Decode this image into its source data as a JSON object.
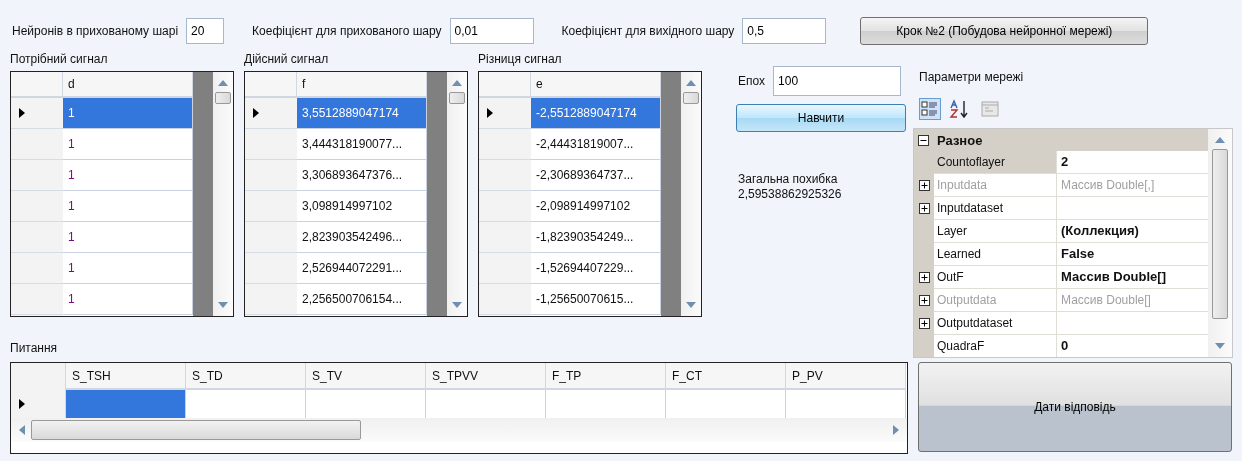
{
  "settings": [
    {
      "label": "Нейронів в прихованому шарі",
      "value": "20"
    },
    {
      "label": "Коефіцієнт для прихованого шару",
      "value": "0,01"
    },
    {
      "label": "Коефіцієнт для вихідного шару",
      "value": "0,5"
    }
  ],
  "build_button": "Крок №2 (Побудова нейронної мережі)",
  "grids": [
    {
      "title": "Потрібний сигнал",
      "column": "d",
      "rows": [
        {
          "value": "1",
          "selected": true
        },
        {
          "value": "1",
          "selected": false
        },
        {
          "value": "1",
          "selected": false
        },
        {
          "value": "1",
          "selected": false
        },
        {
          "value": "1",
          "selected": false
        },
        {
          "value": "1",
          "selected": false
        },
        {
          "value": "1",
          "selected": false
        }
      ]
    },
    {
      "title": "Дійсний сигнал",
      "column": "f",
      "rows": [
        {
          "value": "3,5512889047174",
          "selected": true
        },
        {
          "value": "3,444318190077...",
          "selected": false
        },
        {
          "value": "3,306893647376...",
          "selected": false
        },
        {
          "value": "3,098914997102",
          "selected": false
        },
        {
          "value": "2,823903542496...",
          "selected": false
        },
        {
          "value": "2,526944072291...",
          "selected": false
        },
        {
          "value": "2,256500706154...",
          "selected": false
        }
      ]
    },
    {
      "title": "Різниця сигнал",
      "column": "e",
      "rows": [
        {
          "value": "-2,5512889047174",
          "selected": true
        },
        {
          "value": "-2,44431819007...",
          "selected": false
        },
        {
          "value": "-2,30689364737...",
          "selected": false
        },
        {
          "value": "-2,098914997102",
          "selected": false
        },
        {
          "value": "-1,82390354249...",
          "selected": false
        },
        {
          "value": "-1,52694407229...",
          "selected": false
        },
        {
          "value": "-1,25650070615...",
          "selected": false
        }
      ]
    }
  ],
  "epochs": {
    "label": "Епох",
    "value": "100"
  },
  "train_button": "Навчити",
  "total_error": {
    "label": "Загальна похибка",
    "value": "2,59538862925326"
  },
  "properties": {
    "title": "Параметри мережі",
    "toolbar": [
      {
        "kind": "categorized",
        "selected": true
      },
      {
        "kind": "alphabetical",
        "selected": false
      },
      {
        "kind": "pages",
        "selected": false
      }
    ],
    "category": "Разное",
    "rows": [
      {
        "name": "Countoflayer",
        "value": "2",
        "expandable": false,
        "disabled": false,
        "bold": true,
        "selected": true
      },
      {
        "name": "Inputdata",
        "value": "Массив Double[,]",
        "expandable": true,
        "disabled": true,
        "bold": false,
        "selected": false
      },
      {
        "name": "Inputdataset",
        "expandable": true,
        "disabled": false,
        "bold": false,
        "selected": false
      },
      {
        "name": "Layer",
        "value": "(Коллекция)",
        "expandable": false,
        "disabled": false,
        "bold": true,
        "selected": false
      },
      {
        "name": "Learned",
        "value": "False",
        "expandable": false,
        "disabled": false,
        "bold": true,
        "selected": false
      },
      {
        "name": "OutF",
        "value": "Массив Double[]",
        "expandable": true,
        "disabled": false,
        "bold": true,
        "selected": false
      },
      {
        "name": "Outputdata",
        "value": "Массив Double[]",
        "expandable": true,
        "disabled": true,
        "bold": false,
        "selected": false
      },
      {
        "name": "Outputdataset",
        "expandable": true,
        "disabled": false,
        "bold": false,
        "selected": false
      },
      {
        "name": "QuadraF",
        "value": "0",
        "expandable": false,
        "disabled": false,
        "bold": true,
        "selected": false
      }
    ]
  },
  "question": {
    "title": "Питання",
    "columns": [
      "S_TSH",
      "S_TD",
      "S_TV",
      "S_TPVV",
      "F_TP",
      "F_CT",
      "P_PV"
    ],
    "cells": [
      {
        "selected": true
      },
      {
        "selected": false
      },
      {
        "selected": false
      },
      {
        "selected": false
      },
      {
        "selected": false
      },
      {
        "selected": false
      },
      {
        "selected": false
      }
    ]
  },
  "answer_button": "Дати відповідь"
}
